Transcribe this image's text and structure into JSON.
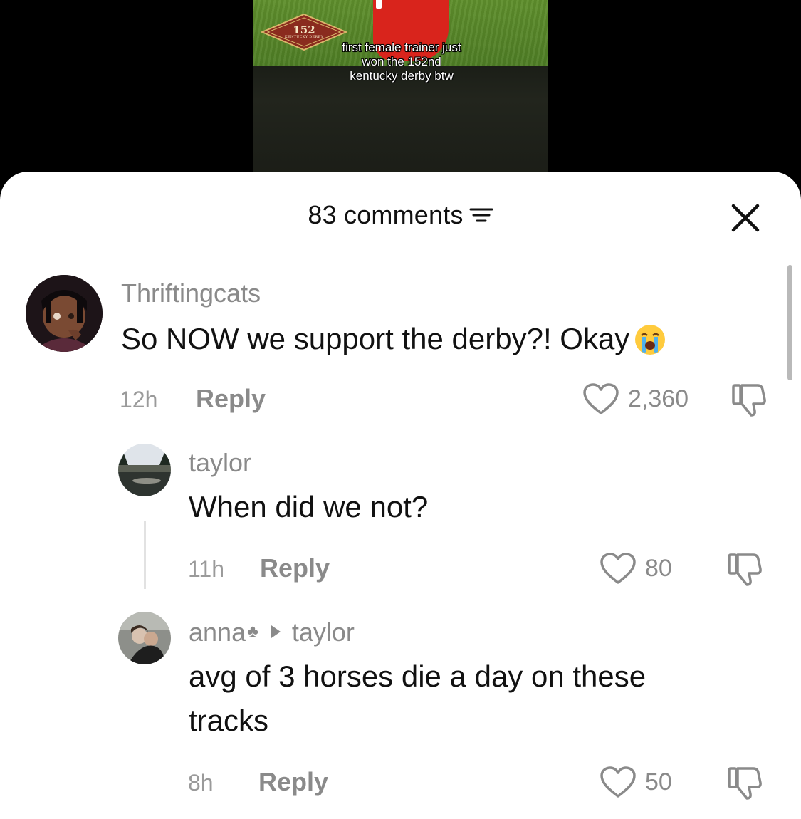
{
  "video": {
    "caption_line1": "first female trainer just",
    "caption_line2": "won the 152nd",
    "caption_line3": "kentucky derby btw",
    "logo_number": "152",
    "logo_text": "KENTUCKY DERBY"
  },
  "sheet": {
    "comment_count": "83 comments",
    "sort_icon": "filter-lines-icon",
    "close_icon": "close-icon"
  },
  "comments": [
    {
      "username": "Thriftingcats",
      "text": "So NOW we support the derby?! Okay",
      "emoji": "crying-face-icon",
      "time": "12h",
      "reply_label": "Reply",
      "likes": "2,360"
    },
    {
      "username": "taylor",
      "text": "When did we not?",
      "time": "11h",
      "reply_label": "Reply",
      "likes": "80"
    },
    {
      "username": "anna",
      "reply_to": "taylor",
      "text_line1": "avg of 3 horses die a day on these",
      "text_line2": "tracks",
      "time": "8h",
      "reply_label": "Reply",
      "likes": "50"
    }
  ],
  "colors": {
    "text_primary": "#111111",
    "text_secondary": "#8a8a8a",
    "sheet_bg": "#ffffff",
    "backdrop": "#000000"
  }
}
